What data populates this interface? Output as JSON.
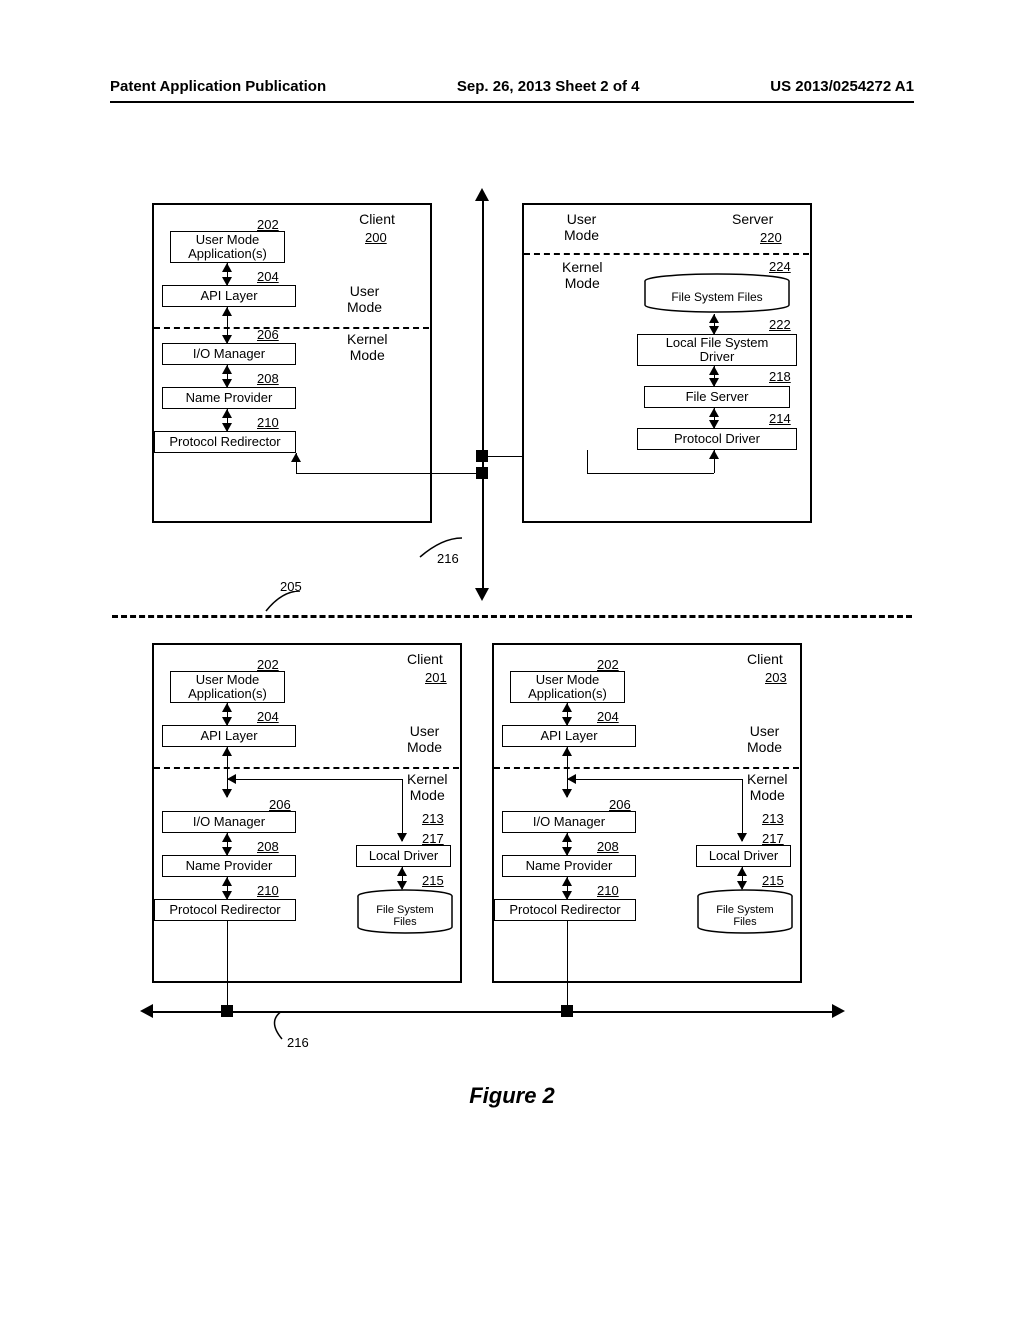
{
  "header": {
    "left": "Patent Application Publication",
    "center": "Sep. 26, 2013  Sheet 2 of 4",
    "right": "US 2013/0254272 A1"
  },
  "figure_title": "Figure 2",
  "labels": {
    "client": "Client",
    "server": "Server",
    "user_mode": "User\nMode",
    "kernel_mode": "Kernel\nMode"
  },
  "boxes": {
    "user_mode_apps": "User Mode\nApplication(s)",
    "api_layer": "API Layer",
    "io_manager": "I/O Manager",
    "name_provider": "Name Provider",
    "protocol_redirector": "Protocol Redirector",
    "file_system_files": "File System Files",
    "local_fs_driver": "Local File System\nDriver",
    "file_server": "File Server",
    "protocol_driver": "Protocol Driver",
    "local_driver": "Local Driver",
    "fs_files_short": "File System\nFiles"
  },
  "refs": {
    "r200": "200",
    "r201": "201",
    "r202": "202",
    "r203": "203",
    "r204": "204",
    "r205": "205",
    "r206": "206",
    "r208": "208",
    "r210": "210",
    "r213": "213",
    "r214": "214",
    "r215": "215",
    "r216": "216",
    "r217": "217",
    "r218": "218",
    "r220": "220",
    "r222": "222",
    "r224": "224"
  }
}
